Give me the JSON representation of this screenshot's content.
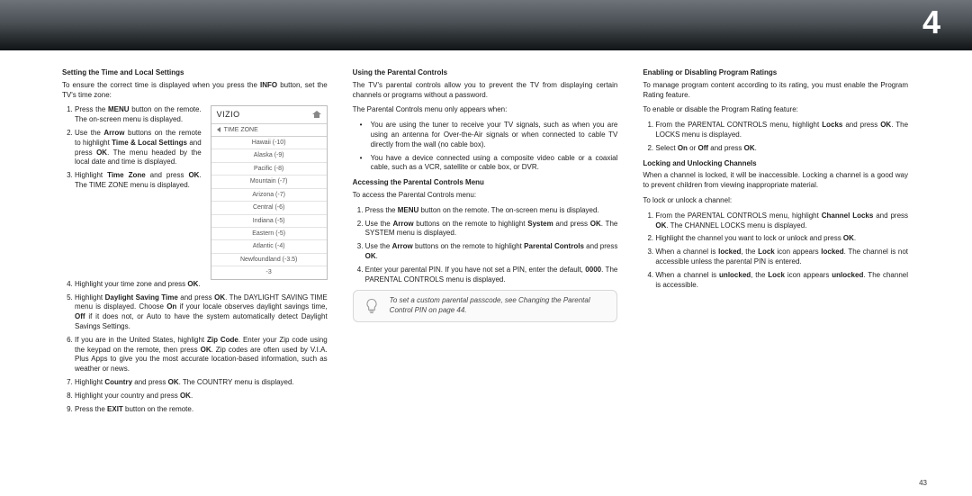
{
  "chapter_number": "4",
  "page_number": "43",
  "col1": {
    "h1": "Setting the Time and Local Settings",
    "intro_a": "To ensure the correct time is displayed when you press the ",
    "intro_b": "INFO",
    "intro_c": " button, set the TV's time zone:",
    "s1_a": "Press the ",
    "s1_b": "MENU",
    "s1_c": " button on the remote. The on-screen menu is displayed.",
    "s2_a": "Use the ",
    "s2_b": "Arrow",
    "s2_c": " buttons on the remote to highlight ",
    "s2_d": "Time & Local Settings",
    "s2_e": " and press ",
    "s2_f": "OK",
    "s2_g": ". The menu headed by the local date and time is displayed.",
    "s3_a": "Highlight ",
    "s3_b": "Time Zone",
    "s3_c": " and press ",
    "s3_d": "OK",
    "s3_e": ". The TIME ZONE menu is displayed.",
    "s4_a": "Highlight your time zone and press ",
    "s4_b": "OK",
    "s4_c": ".",
    "s5_a": "Highlight ",
    "s5_b": "Daylight Saving Time",
    "s5_c": " and press ",
    "s5_d": "OK",
    "s5_e": ". The DAYLIGHT SAVING TIME menu is displayed. Choose ",
    "s5_f": "On",
    "s5_g": " if your locale observes daylight savings time, ",
    "s5_h": "Off",
    "s5_i": " if it does not, or Auto to have the system automatically detect Daylight Savings Settings.",
    "s6_a": "If you are in the United States, highlight ",
    "s6_b": "Zip Code",
    "s6_c": ". Enter your Zip code using the keypad on the remote, then press ",
    "s6_d": "OK",
    "s6_e": ". Zip codes are often used by V.I.A. Plus Apps to give you the most accurate location-based information, such as weather or news.",
    "s7_a": "Highlight ",
    "s7_b": "Country",
    "s7_c": " and press ",
    "s7_d": "OK",
    "s7_e": ". The COUNTRY menu is displayed.",
    "s8_a": "Highlight your country and press ",
    "s8_b": "OK",
    "s8_c": ".",
    "s9_a": "Press the ",
    "s9_b": "EXIT",
    "s9_c": " button on the remote.",
    "tz_logo": "VIZIO",
    "tz_label": "TIME ZONE",
    "tz_items": [
      "Hawaii (-10)",
      "Alaska (-9)",
      "Pacific (-8)",
      "Mountain (-7)",
      "Arizona (-7)",
      "Central (-6)",
      "Indiana (-5)",
      "Eastern (-5)",
      "Atlantic (-4)",
      "Newfoundland (-3.5)"
    ],
    "tz_footer": "-3"
  },
  "col2": {
    "h1": "Using the Parental Controls",
    "p1": "The TV's parental controls allow you to prevent the TV from displaying certain channels or programs without a password.",
    "p2": "The Parental Controls menu only appears when:",
    "b1": "You are using the tuner to receive your TV signals, such as when you are using an antenna for Over-the-Air signals or when connected to cable TV directly from the wall (no cable box).",
    "b2": "You have a device connected using a composite video cable or a coaxial cable, such as a VCR, satellite or cable box, or DVR.",
    "h2": "Accessing the Parental Controls Menu",
    "p3": "To access the Parental Controls menu:",
    "s1_a": "Press the ",
    "s1_b": "MENU",
    "s1_c": " button on the remote. The on-screen menu is displayed.",
    "s2_a": "Use the ",
    "s2_b": "Arrow",
    "s2_c": " buttons on the remote to highlight ",
    "s2_d": "System",
    "s2_e": " and press ",
    "s2_f": "OK",
    "s2_g": ". The SYSTEM menu is displayed.",
    "s3_a": "Use the ",
    "s3_b": "Arrow",
    "s3_c": " buttons on the remote to highlight ",
    "s3_d": "Parental Controls",
    "s3_e": " and press ",
    "s3_f": "OK",
    "s3_g": ".",
    "s4_a": "Enter your parental PIN. If you have not set a PIN, enter the default, ",
    "s4_b": "0000",
    "s4_c": ". The PARENTAL CONTROLS menu is displayed.",
    "tip_a": "To set a custom parental passcode, see ",
    "tip_b": "Changing the Parental Control PIN",
    "tip_c": " on page 44."
  },
  "col3": {
    "h1": "Enabling or Disabling Program Ratings",
    "p1": "To manage program content according to its rating, you must enable the Program Rating feature.",
    "p2": "To enable or disable the Program Rating feature:",
    "s1_a": "From the PARENTAL CONTROLS menu, highlight ",
    "s1_b": "Locks",
    "s1_c": " and press ",
    "s1_d": "OK",
    "s1_e": ". The LOCKS menu is displayed.",
    "s2_a": "Select ",
    "s2_b": "On",
    "s2_c": " or ",
    "s2_d": "Off",
    "s2_e": " and press ",
    "s2_f": "OK",
    "s2_g": ".",
    "h2": "Locking and Unlocking Channels",
    "p3": "When a channel is locked, it will be inaccessible. Locking a channel is a good way to prevent children from viewing inappropriate material.",
    "p4": "To lock or unlock a channel:",
    "t1_a": "From the PARENTAL CONTROLS menu, highlight ",
    "t1_b": "Channel Locks",
    "t1_c": " and press ",
    "t1_d": "OK",
    "t1_e": ". The CHANNEL LOCKS menu is displayed.",
    "t2_a": "Highlight the channel you want to lock or unlock and press ",
    "t2_b": "OK",
    "t2_c": ".",
    "t3_a": "When a channel is ",
    "t3_b": "locked",
    "t3_c": ", the ",
    "t3_d": "Lock",
    "t3_e": " icon appears ",
    "t3_f": "locked",
    "t3_g": ". The channel is not accessible unless the parental PIN is entered.",
    "t4_a": "When a channel is ",
    "t4_b": "unlocked",
    "t4_c": ", the ",
    "t4_d": "Lock",
    "t4_e": " icon appears ",
    "t4_f": "unlocked",
    "t4_g": ". The channel is accessible."
  }
}
